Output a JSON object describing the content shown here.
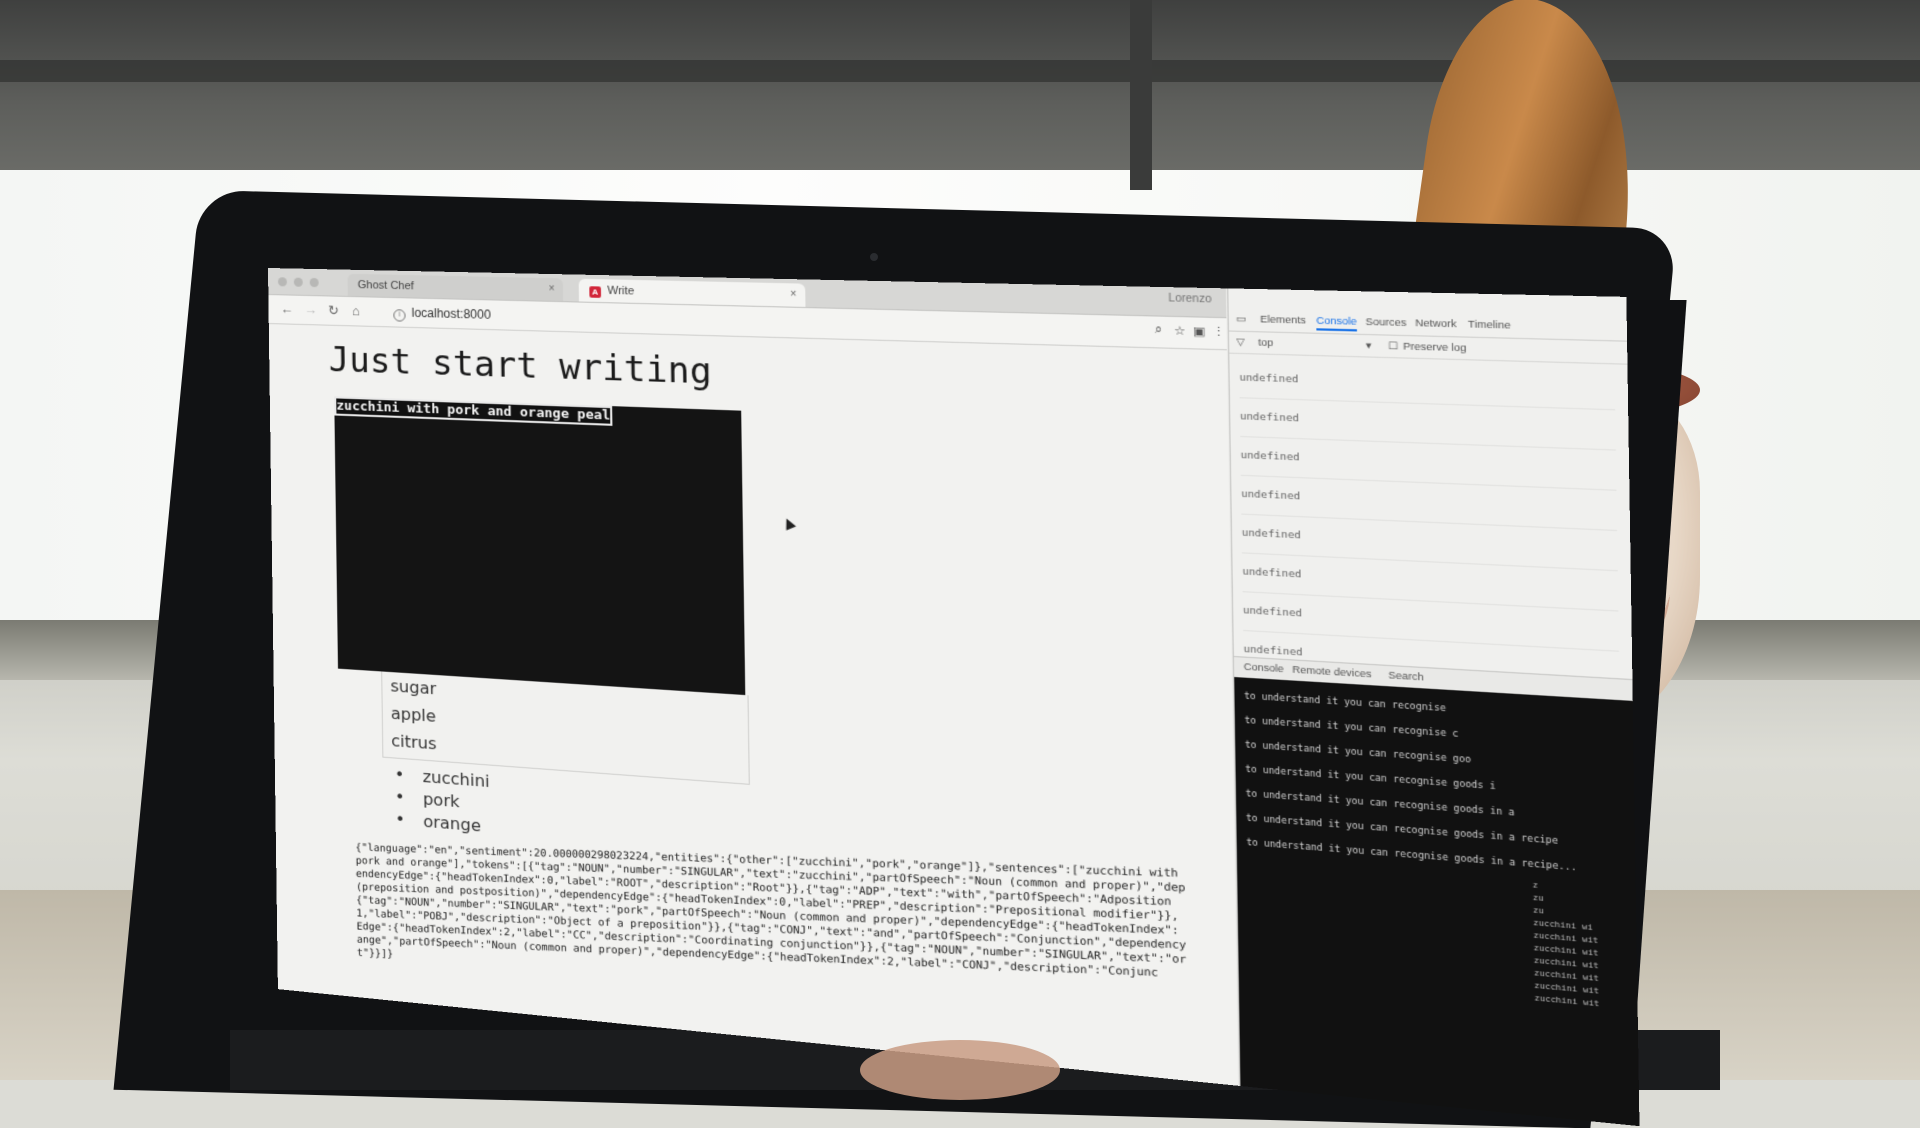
{
  "browser": {
    "tabs": [
      {
        "label": "Ghost Chef",
        "active": false
      },
      {
        "label": "Write",
        "active": true
      }
    ],
    "profile_name": "Lorenzo",
    "url": "localhost:8000"
  },
  "page": {
    "title": "Just start writing",
    "editor_text": "zucchini with pork and orange peal",
    "suggestions": [
      "sugar",
      "apple",
      "citrus"
    ],
    "entities": [
      "zucchini",
      "pork",
      "orange"
    ],
    "json_output": "{\"language\":\"en\",\"sentiment\":20.000000298023224,\"entities\":{\"other\":[\"zucchini\",\"pork\",\"orange\"]},\"sentences\":[\"zucchini with pork and orange\"],\"tokens\":[{\"tag\":\"NOUN\",\"number\":\"SINGULAR\",\"text\":\"zucchini\",\"partOfSpeech\":\"Noun (common and proper)\",\"dependencyEdge\":{\"headTokenIndex\":0,\"label\":\"ROOT\",\"description\":\"Root\"}},{\"tag\":\"ADP\",\"text\":\"with\",\"partOfSpeech\":\"Adposition (preposition and postposition)\",\"dependencyEdge\":{\"headTokenIndex\":0,\"label\":\"PREP\",\"description\":\"Prepositional modifier\"}},{\"tag\":\"NOUN\",\"number\":\"SINGULAR\",\"text\":\"pork\",\"partOfSpeech\":\"Noun (common and proper)\",\"dependencyEdge\":{\"headTokenIndex\":1,\"label\":\"POBJ\",\"description\":\"Object of a preposition\"}},{\"tag\":\"CONJ\",\"text\":\"and\",\"partOfSpeech\":\"Conjunction\",\"dependencyEdge\":{\"headTokenIndex\":2,\"label\":\"CC\",\"description\":\"Coordinating conjunction\"}},{\"tag\":\"NOUN\",\"number\":\"SINGULAR\",\"text\":\"orange\",\"partOfSpeech\":\"Noun (common and proper)\",\"dependencyEdge\":{\"headTokenIndex\":2,\"label\":\"CONJ\",\"description\":\"Conjunct\"}}]}"
  },
  "devtools": {
    "tabs": [
      "Elements",
      "Console",
      "Sources",
      "Network",
      "Timeline"
    ],
    "active_tab": "Console",
    "context": "top",
    "preserve_log_label": "Preserve log",
    "console_lines": [
      "undefined",
      "undefined",
      "undefined",
      "undefined",
      "undefined",
      "undefined",
      "undefined",
      "undefined"
    ],
    "drawer_tabs": [
      "Console",
      "Remote devices",
      "Search"
    ],
    "terminal_lines": [
      "to understand it you can recognise",
      "to understand it you can recognise c",
      "to understand it you can recognise goo",
      "to understand it you can recognise goods i",
      "to understand it you can recognise goods in a",
      "to understand it you can recognise goods in a recipe",
      "to understand it you can recognise goods in a recipe..."
    ],
    "terminal_column": [
      "z",
      "zu",
      "zu",
      "zucchini wi",
      "zucchini wit",
      "zucchini wit",
      "zucchini wit",
      "zucchini wit",
      "zucchini wit",
      "zucchini wit"
    ]
  }
}
